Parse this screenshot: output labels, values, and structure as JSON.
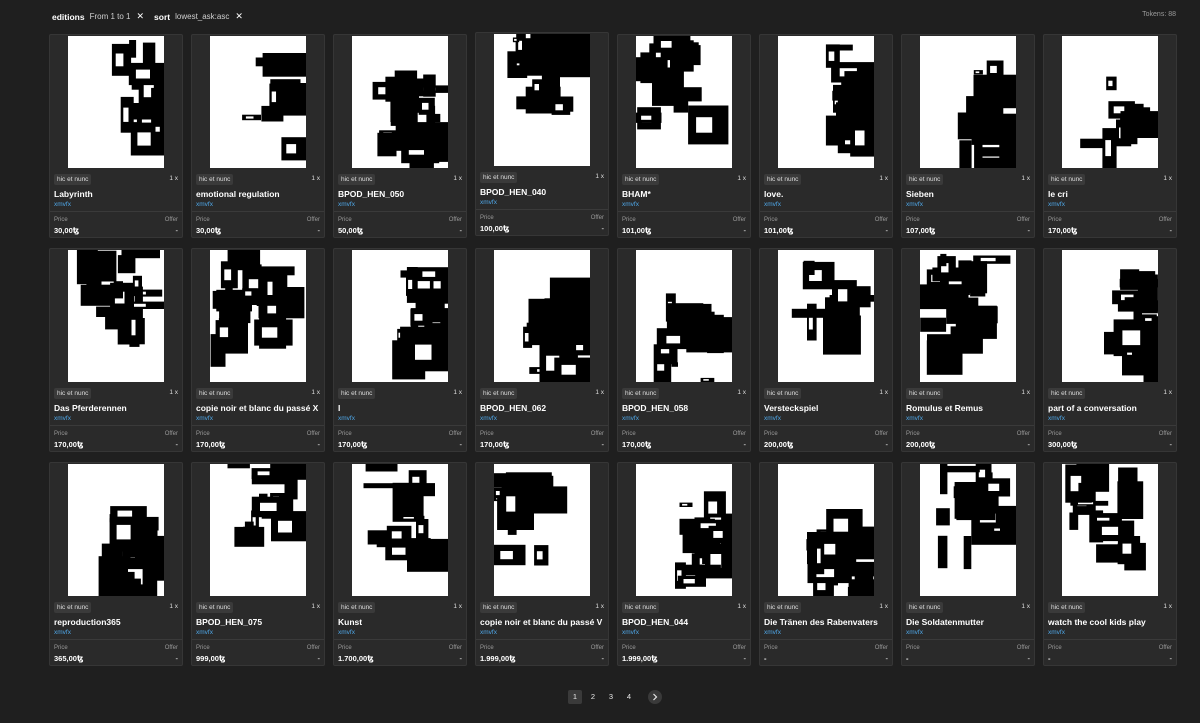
{
  "filters": [
    {
      "key": "editions",
      "value": "From 1 to 1"
    },
    {
      "key": "sort",
      "value": "lowest_ask:asc"
    }
  ],
  "tokens_label": "Tokens: 88",
  "labels": {
    "price": "Price",
    "offer": "Offer"
  },
  "cards": [
    {
      "tag": "hic et nunc",
      "qty": "1 x",
      "title": "Labyrinth",
      "artist": "xmvfx",
      "price": "30,00ꜩ",
      "offer": "-"
    },
    {
      "tag": "hic et nunc",
      "qty": "1 x",
      "title": "emotional regulation",
      "artist": "xmvfx",
      "price": "30,00ꜩ",
      "offer": "-"
    },
    {
      "tag": "hic et nunc",
      "qty": "1 x",
      "title": "BPOD_HEN_050",
      "artist": "xmvfx",
      "price": "50,00ꜩ",
      "offer": "-"
    },
    {
      "tag": "hic et nunc",
      "qty": "1 x",
      "title": "BPOD_HEN_040",
      "artist": "xmvfx",
      "price": "100,00ꜩ",
      "offer": "-"
    },
    {
      "tag": "hic et nunc",
      "qty": "1 x",
      "title": "BHAM*",
      "artist": "xmvfx",
      "price": "101,00ꜩ",
      "offer": "-"
    },
    {
      "tag": "hic et nunc",
      "qty": "1 x",
      "title": "love.",
      "artist": "xmvfx",
      "price": "101,00ꜩ",
      "offer": "-"
    },
    {
      "tag": "hic et nunc",
      "qty": "1 x",
      "title": "Sieben",
      "artist": "xmvfx",
      "price": "107,00ꜩ",
      "offer": "-"
    },
    {
      "tag": "hic et nunc",
      "qty": "1 x",
      "title": "le cri",
      "artist": "xmvfx",
      "price": "170,00ꜩ",
      "offer": "-"
    },
    {
      "tag": "hic et nunc",
      "qty": "1 x",
      "title": "Das Pferderennen",
      "artist": "xmvfx",
      "price": "170,00ꜩ",
      "offer": "-"
    },
    {
      "tag": "hic et nunc",
      "qty": "1 x",
      "title": "copie noir et blanc du passé X",
      "artist": "xmvfx",
      "price": "170,00ꜩ",
      "offer": "-"
    },
    {
      "tag": "hic et nunc",
      "qty": "1 x",
      "title": "I",
      "artist": "xmvfx",
      "price": "170,00ꜩ",
      "offer": "-"
    },
    {
      "tag": "hic et nunc",
      "qty": "1 x",
      "title": "BPOD_HEN_062",
      "artist": "xmvfx",
      "price": "170,00ꜩ",
      "offer": "-"
    },
    {
      "tag": "hic et nunc",
      "qty": "1 x",
      "title": "BPOD_HEN_058",
      "artist": "xmvfx",
      "price": "170,00ꜩ",
      "offer": "-"
    },
    {
      "tag": "hic et nunc",
      "qty": "1 x",
      "title": "Versteckspiel",
      "artist": "xmvfx",
      "price": "200,00ꜩ",
      "offer": "-"
    },
    {
      "tag": "hic et nunc",
      "qty": "1 x",
      "title": "Romulus et Remus",
      "artist": "xmvfx",
      "price": "200,00ꜩ",
      "offer": "-"
    },
    {
      "tag": "hic et nunc",
      "qty": "1 x",
      "title": "part of a conversation",
      "artist": "xmvfx",
      "price": "300,00ꜩ",
      "offer": "-"
    },
    {
      "tag": "hic et nunc",
      "qty": "1 x",
      "title": "reproduction365",
      "artist": "xmvfx",
      "price": "365,00ꜩ",
      "offer": "-"
    },
    {
      "tag": "hic et nunc",
      "qty": "1 x",
      "title": "BPOD_HEN_075",
      "artist": "xmvfx",
      "price": "999,00ꜩ",
      "offer": "-"
    },
    {
      "tag": "hic et nunc",
      "qty": "1 x",
      "title": "Kunst",
      "artist": "xmvfx",
      "price": "1.700,00ꜩ",
      "offer": "-"
    },
    {
      "tag": "hic et nunc",
      "qty": "1 x",
      "title": "copie noir et blanc du passé V",
      "artist": "xmvfx",
      "price": "1.999,00ꜩ",
      "offer": "-"
    },
    {
      "tag": "hic et nunc",
      "qty": "1 x",
      "title": "BPOD_HEN_044",
      "artist": "xmvfx",
      "price": "1.999,00ꜩ",
      "offer": "-"
    },
    {
      "tag": "hic et nunc",
      "qty": "1 x",
      "title": "Die Tränen des Rabenvaters",
      "artist": "xmvfx",
      "price": "-",
      "offer": "-"
    },
    {
      "tag": "hic et nunc",
      "qty": "1 x",
      "title": "Die Soldatenmutter",
      "artist": "xmvfx",
      "price": "-",
      "offer": "-"
    },
    {
      "tag": "hic et nunc",
      "qty": "1 x",
      "title": "watch the cool kids play",
      "artist": "xmvfx",
      "price": "-",
      "offer": "-"
    }
  ],
  "pagination": {
    "pages": [
      "1",
      "2",
      "3",
      "4"
    ],
    "active": "1",
    "next_icon": "chevron-right-icon"
  }
}
